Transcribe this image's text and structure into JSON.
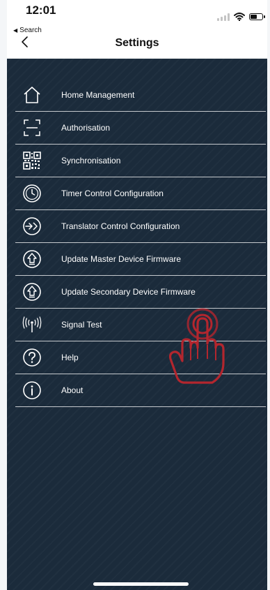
{
  "status": {
    "time": "12:01",
    "back_app": "Search",
    "signal_icon": "cellular-signal-icon",
    "wifi_icon": "wifi-icon",
    "battery_level": 0.65
  },
  "header": {
    "title": "Settings"
  },
  "menu": [
    {
      "label": "Home Management",
      "icon": "home-icon"
    },
    {
      "label": "Authorisation",
      "icon": "scan-frame-icon"
    },
    {
      "label": "Synchronisation",
      "icon": "qr-code-icon"
    },
    {
      "label": "Timer Control Configuration",
      "icon": "clock-icon"
    },
    {
      "label": "Translator Control Configuration",
      "icon": "translator-icon"
    },
    {
      "label": "Update Master Device Firmware",
      "icon": "upload-arrow-icon"
    },
    {
      "label": "Update Secondary Device Firmware",
      "icon": "upload-arrow-icon"
    },
    {
      "label": "Signal Test",
      "icon": "antenna-icon"
    },
    {
      "label": "Help",
      "icon": "question-icon"
    },
    {
      "label": "About",
      "icon": "info-icon"
    }
  ],
  "colors": {
    "background": "#1b2b3b",
    "text": "#ffffff",
    "tap_hint": "#b3262e"
  }
}
